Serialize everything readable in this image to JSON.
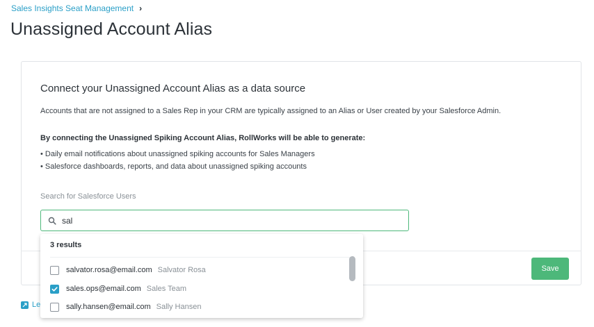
{
  "breadcrumb": {
    "parent": "Sales Insights Seat Management",
    "separator": "›"
  },
  "page_title": "Unassigned Account Alias",
  "section": {
    "title": "Connect your Unassigned Account Alias as a data source",
    "description": "Accounts that are not assigned to a Sales Rep in your CRM are typically assigned to an Alias or User created by your Salesforce Admin.",
    "bold_line": "By connecting the Unassigned Spiking Account Alias, RollWorks will be able to generate:",
    "bullets": [
      "• Daily email notifications about unassigned spiking accounts for Sales Managers",
      "• Salesforce dashboards, reports, and data about unassigned spiking accounts"
    ]
  },
  "search": {
    "label": "Search for Salesforce Users",
    "value": "sal",
    "icon": "search-icon"
  },
  "dropdown": {
    "results_count": "3 results",
    "results": [
      {
        "email": "salvator.rosa@email.com",
        "name": "Salvator Rosa",
        "checked": false
      },
      {
        "email": "sales.ops@email.com",
        "name": "Sales Team",
        "checked": true
      },
      {
        "email": "sally.hansen@email.com",
        "name": "Sally Hansen",
        "checked": false
      }
    ]
  },
  "actions": {
    "save_label": "Save"
  },
  "footer": {
    "learn_link_visible": "Le"
  },
  "colors": {
    "accent": "#2a9fc7",
    "success": "#4db87a",
    "text": "#2c3238",
    "muted": "#8a9197"
  }
}
